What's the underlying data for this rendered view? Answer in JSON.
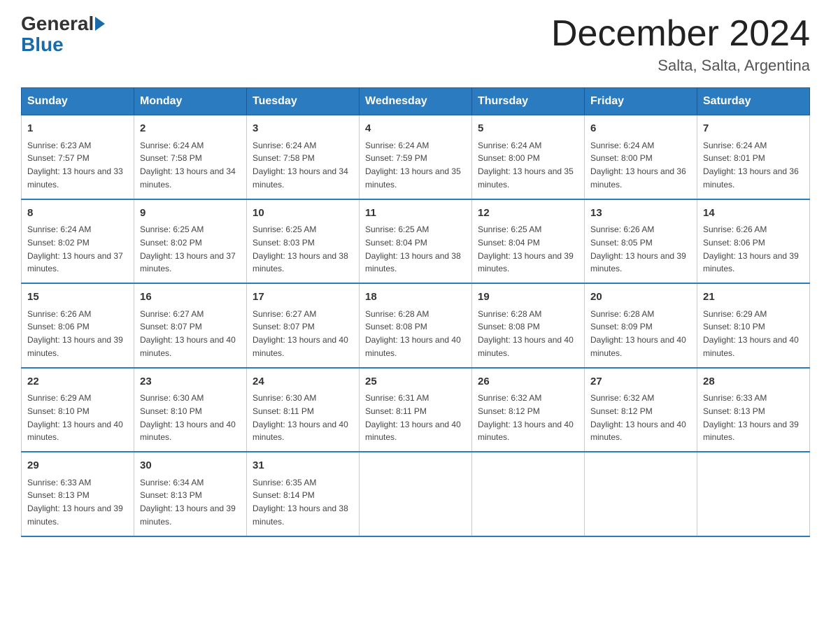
{
  "header": {
    "logo_general": "General",
    "logo_blue": "Blue",
    "month_title": "December 2024",
    "location": "Salta, Salta, Argentina"
  },
  "weekdays": [
    "Sunday",
    "Monday",
    "Tuesday",
    "Wednesday",
    "Thursday",
    "Friday",
    "Saturday"
  ],
  "weeks": [
    [
      {
        "day": "1",
        "sunrise": "6:23 AM",
        "sunset": "7:57 PM",
        "daylight": "13 hours and 33 minutes."
      },
      {
        "day": "2",
        "sunrise": "6:24 AM",
        "sunset": "7:58 PM",
        "daylight": "13 hours and 34 minutes."
      },
      {
        "day": "3",
        "sunrise": "6:24 AM",
        "sunset": "7:58 PM",
        "daylight": "13 hours and 34 minutes."
      },
      {
        "day": "4",
        "sunrise": "6:24 AM",
        "sunset": "7:59 PM",
        "daylight": "13 hours and 35 minutes."
      },
      {
        "day": "5",
        "sunrise": "6:24 AM",
        "sunset": "8:00 PM",
        "daylight": "13 hours and 35 minutes."
      },
      {
        "day": "6",
        "sunrise": "6:24 AM",
        "sunset": "8:00 PM",
        "daylight": "13 hours and 36 minutes."
      },
      {
        "day": "7",
        "sunrise": "6:24 AM",
        "sunset": "8:01 PM",
        "daylight": "13 hours and 36 minutes."
      }
    ],
    [
      {
        "day": "8",
        "sunrise": "6:24 AM",
        "sunset": "8:02 PM",
        "daylight": "13 hours and 37 minutes."
      },
      {
        "day": "9",
        "sunrise": "6:25 AM",
        "sunset": "8:02 PM",
        "daylight": "13 hours and 37 minutes."
      },
      {
        "day": "10",
        "sunrise": "6:25 AM",
        "sunset": "8:03 PM",
        "daylight": "13 hours and 38 minutes."
      },
      {
        "day": "11",
        "sunrise": "6:25 AM",
        "sunset": "8:04 PM",
        "daylight": "13 hours and 38 minutes."
      },
      {
        "day": "12",
        "sunrise": "6:25 AM",
        "sunset": "8:04 PM",
        "daylight": "13 hours and 39 minutes."
      },
      {
        "day": "13",
        "sunrise": "6:26 AM",
        "sunset": "8:05 PM",
        "daylight": "13 hours and 39 minutes."
      },
      {
        "day": "14",
        "sunrise": "6:26 AM",
        "sunset": "8:06 PM",
        "daylight": "13 hours and 39 minutes."
      }
    ],
    [
      {
        "day": "15",
        "sunrise": "6:26 AM",
        "sunset": "8:06 PM",
        "daylight": "13 hours and 39 minutes."
      },
      {
        "day": "16",
        "sunrise": "6:27 AM",
        "sunset": "8:07 PM",
        "daylight": "13 hours and 40 minutes."
      },
      {
        "day": "17",
        "sunrise": "6:27 AM",
        "sunset": "8:07 PM",
        "daylight": "13 hours and 40 minutes."
      },
      {
        "day": "18",
        "sunrise": "6:28 AM",
        "sunset": "8:08 PM",
        "daylight": "13 hours and 40 minutes."
      },
      {
        "day": "19",
        "sunrise": "6:28 AM",
        "sunset": "8:08 PM",
        "daylight": "13 hours and 40 minutes."
      },
      {
        "day": "20",
        "sunrise": "6:28 AM",
        "sunset": "8:09 PM",
        "daylight": "13 hours and 40 minutes."
      },
      {
        "day": "21",
        "sunrise": "6:29 AM",
        "sunset": "8:10 PM",
        "daylight": "13 hours and 40 minutes."
      }
    ],
    [
      {
        "day": "22",
        "sunrise": "6:29 AM",
        "sunset": "8:10 PM",
        "daylight": "13 hours and 40 minutes."
      },
      {
        "day": "23",
        "sunrise": "6:30 AM",
        "sunset": "8:10 PM",
        "daylight": "13 hours and 40 minutes."
      },
      {
        "day": "24",
        "sunrise": "6:30 AM",
        "sunset": "8:11 PM",
        "daylight": "13 hours and 40 minutes."
      },
      {
        "day": "25",
        "sunrise": "6:31 AM",
        "sunset": "8:11 PM",
        "daylight": "13 hours and 40 minutes."
      },
      {
        "day": "26",
        "sunrise": "6:32 AM",
        "sunset": "8:12 PM",
        "daylight": "13 hours and 40 minutes."
      },
      {
        "day": "27",
        "sunrise": "6:32 AM",
        "sunset": "8:12 PM",
        "daylight": "13 hours and 40 minutes."
      },
      {
        "day": "28",
        "sunrise": "6:33 AM",
        "sunset": "8:13 PM",
        "daylight": "13 hours and 39 minutes."
      }
    ],
    [
      {
        "day": "29",
        "sunrise": "6:33 AM",
        "sunset": "8:13 PM",
        "daylight": "13 hours and 39 minutes."
      },
      {
        "day": "30",
        "sunrise": "6:34 AM",
        "sunset": "8:13 PM",
        "daylight": "13 hours and 39 minutes."
      },
      {
        "day": "31",
        "sunrise": "6:35 AM",
        "sunset": "8:14 PM",
        "daylight": "13 hours and 38 minutes."
      },
      null,
      null,
      null,
      null
    ]
  ]
}
